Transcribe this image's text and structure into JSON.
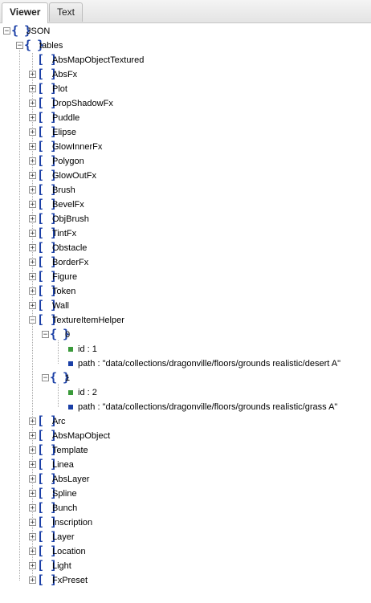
{
  "tabs": [
    {
      "label": "Viewer",
      "active": true
    },
    {
      "label": "Text",
      "active": false
    }
  ],
  "colors": {
    "bracket": "#1a3fa6",
    "number_bullet": "#3a9a3a",
    "string_bullet": "#1a3fa6"
  },
  "tree": {
    "root_label": "JSON",
    "tables_label": "tables",
    "items_before": [
      "AbsMapObjectTextured",
      "AbsFx",
      "Plot",
      "DropShadowFx",
      "Puddle",
      "Elipse",
      "GlowInnerFx",
      "Polygon",
      "GlowOutFx",
      "Brush",
      "BevelFx",
      "ObjBrush",
      "TintFx",
      "Obstacle",
      "BorderFx",
      "Figure",
      "Token",
      "Wall"
    ],
    "expanded_item": {
      "label": "TextureItemHelper",
      "children": [
        {
          "index": "0",
          "id": "id : 1",
          "path": "path : \"data/collections/dragonville/floors/grounds realistic/desert A\""
        },
        {
          "index": "1",
          "id": "id : 2",
          "path": "path : \"data/collections/dragonville/floors/grounds realistic/grass A\""
        }
      ]
    },
    "items_after": [
      "Arc",
      "AbsMapObject",
      "Template",
      "Linea",
      "AbsLayer",
      "Spline",
      "Bunch",
      "Inscription",
      "Layer",
      "Location",
      "Light",
      "FxPreset"
    ]
  }
}
